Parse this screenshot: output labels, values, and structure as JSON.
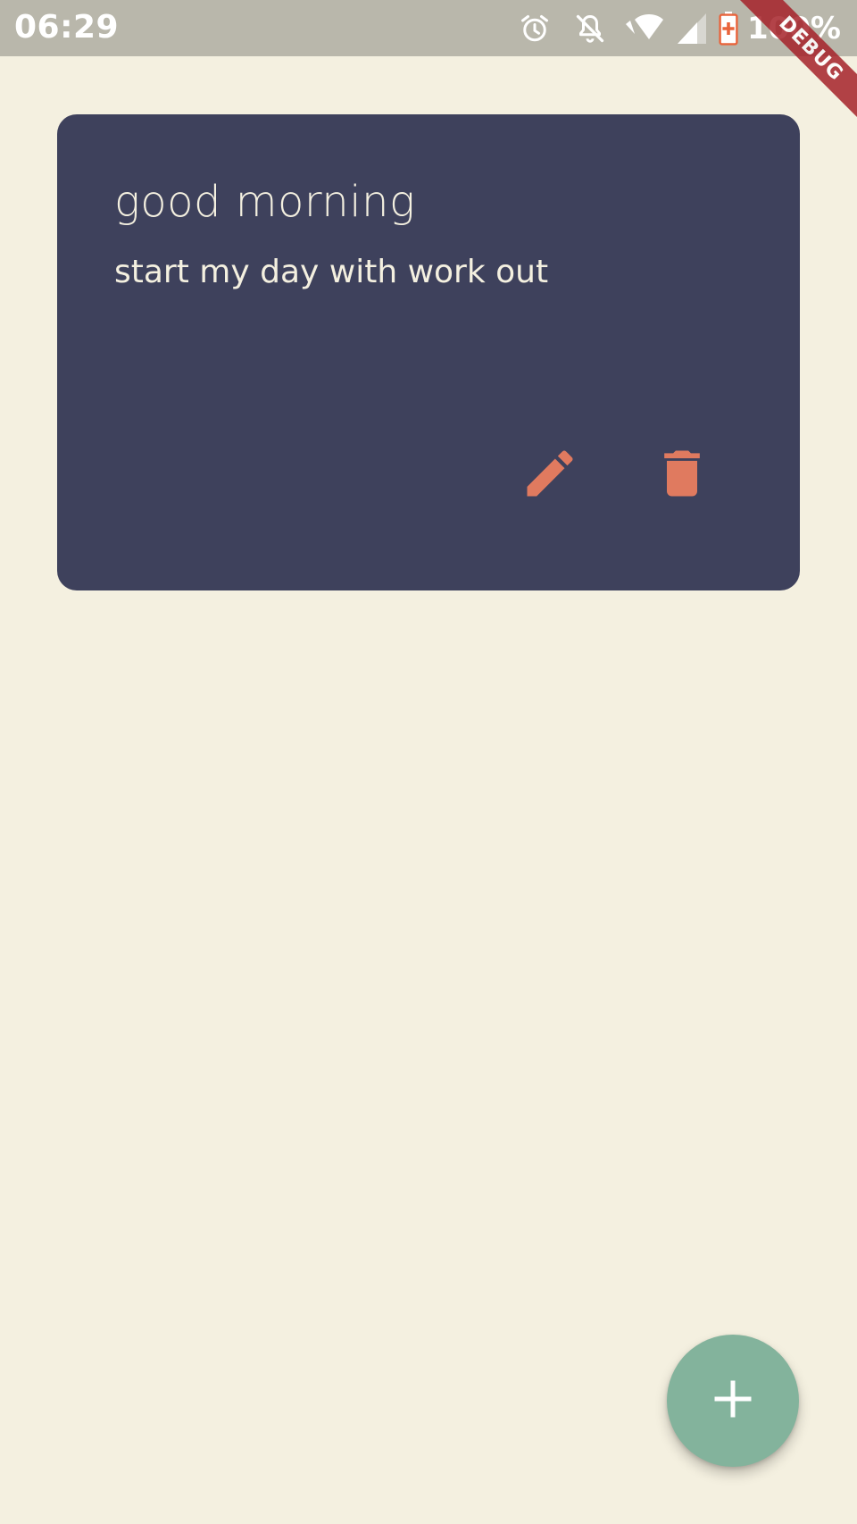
{
  "status_bar": {
    "time": "06:29",
    "battery_percent": "100%",
    "icons": [
      "alarm-icon",
      "notifications-off-icon",
      "wifi-icon",
      "cell-signal-icon",
      "battery-charging-icon"
    ]
  },
  "debug_banner": {
    "label": "DEBUG"
  },
  "note": {
    "title": "good morning",
    "body": "start my day with work out",
    "actions": [
      "edit-icon",
      "delete-icon"
    ]
  },
  "fab": {
    "icon": "add-icon"
  },
  "colors": {
    "background": "#F4F0E0",
    "card": "#3E415C",
    "card_text": "#F4F0E0",
    "action_icon": "#E07A5F",
    "fab": "#83B39C",
    "status_bar": "#B9B7AB",
    "debug_banner": "#A6232A"
  }
}
